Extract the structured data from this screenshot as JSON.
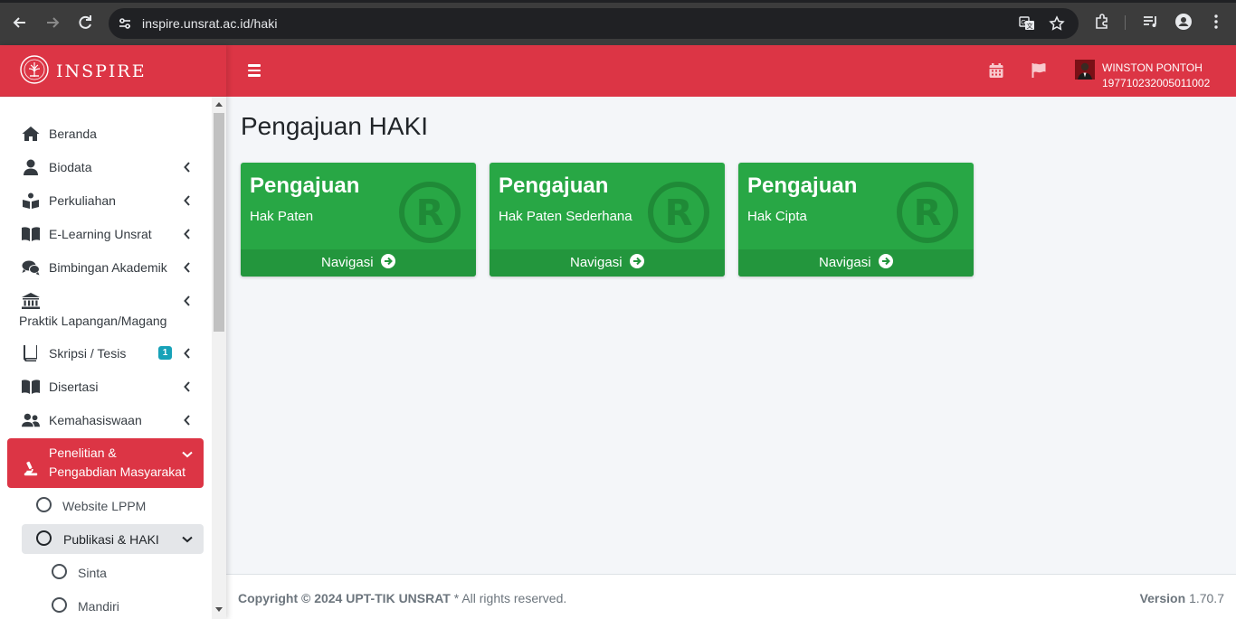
{
  "browser": {
    "url": "inspire.unsrat.ac.id/haki",
    "icons": [
      "back-icon",
      "forward-icon",
      "reload-icon",
      "site-info-icon",
      "translate-icon",
      "bookmark-star-icon",
      "extensions-icon",
      "media-control-icon",
      "profile-icon",
      "kebab-menu-icon"
    ]
  },
  "brand": {
    "name": "INSPIRE"
  },
  "sidebar": {
    "items": [
      {
        "label": "Beranda",
        "icon": "home-icon"
      },
      {
        "label": "Biodata",
        "icon": "user-icon"
      },
      {
        "label": "Perkuliahan",
        "icon": "reader-icon"
      },
      {
        "label": "E-Learning Unsrat",
        "icon": "book-open-icon"
      },
      {
        "label": "Bimbingan Akademik",
        "icon": "comments-icon"
      },
      {
        "label": "Praktik Lapangan/Magang",
        "icon": "institution-icon"
      },
      {
        "label": "Skripsi / Tesis",
        "icon": "book-icon",
        "badge": "1"
      },
      {
        "label": "Disertasi",
        "icon": "book-open-icon"
      },
      {
        "label": "Kemahasiswaan",
        "icon": "users-icon"
      },
      {
        "label_line1": "Penelitian &",
        "label_line2": "Pengabdian Masyarakat",
        "icon": "microscope-icon"
      }
    ],
    "sub_items": [
      {
        "label": "Website LPPM"
      },
      {
        "label": "Publikasi & HAKI"
      },
      {
        "label": "Sinta"
      },
      {
        "label": "Mandiri"
      }
    ]
  },
  "navbar": {
    "user_name": "WINSTON PONTOH",
    "user_id": "197710232005011002"
  },
  "main": {
    "title": "Pengajuan HAKI",
    "cards": [
      {
        "title": "Pengajuan",
        "subtitle": "Hak Paten",
        "nav": "Navigasi"
      },
      {
        "title": "Pengajuan",
        "subtitle": "Hak Paten Sederhana",
        "nav": "Navigasi"
      },
      {
        "title": "Pengajuan",
        "subtitle": "Hak Cipta",
        "nav": "Navigasi"
      }
    ]
  },
  "footer": {
    "copyright": "Copyright © 2024 UPT-TIK UNSRAT",
    "rights": " * All rights reserved.",
    "version_label": "Version",
    "version": "1.70.7"
  },
  "colors": {
    "accent": "#dc3545",
    "card": "#28a745",
    "card_footer": "#23963d",
    "badge": "#17a2b8"
  }
}
